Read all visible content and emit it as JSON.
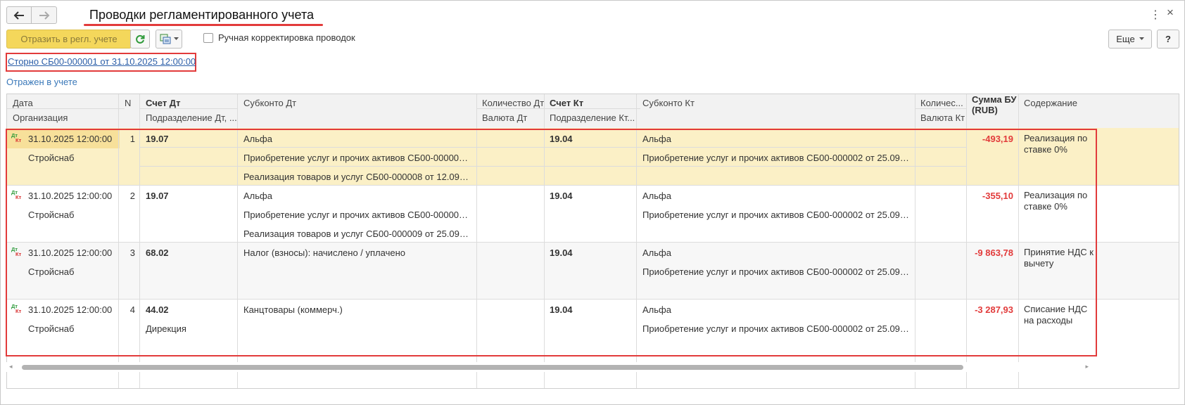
{
  "window": {
    "title": "Проводки регламентированного учета",
    "back_icon": "arrow-left-icon",
    "forward_icon": "arrow-right-icon",
    "menu_icon": "more-vertical-icon",
    "close_icon": "close-icon",
    "close_glyph": "×",
    "menu_glyph": "⋮"
  },
  "toolbar": {
    "post_label": "Отразить в регл. учете",
    "refresh_icon": "refresh-icon",
    "copy_icon": "copy-structure-icon",
    "manual_checkbox_label": "Ручная корректировка проводок",
    "manual_checked": false,
    "more_label": "Еще",
    "help_label": "?"
  },
  "links": {
    "storno": "Сторно СБ00-000001 от 31.10.2025 12:00:00",
    "status": "Отражен в учете"
  },
  "colors": {
    "accent_yellow": "#f4d75b",
    "selected_row": "#fbf0c6",
    "negative": "#e23b3b",
    "link": "#2b5ea8",
    "dt_green": "#2d9a3a",
    "kt_red": "#d83030"
  },
  "table": {
    "headers": {
      "date": "Дата",
      "org": "Организация",
      "n": "N",
      "acc_dt": "Счет Дт",
      "dept_dt": "Подразделение Дт, ...",
      "sub_dt": "Субконто Дт",
      "qty_dt": "Количество Дт",
      "cur_dt": "Валюта Дт",
      "acc_kt": "Счет Кт",
      "dept_kt": "Подразделение Кт...",
      "sub_kt": "Субконто Кт",
      "qty_kt": "Количес...",
      "cur_kt": "Валюта Кт",
      "sum": "Сумма БУ (RUB)",
      "content": "Содержание"
    },
    "dtkt": {
      "dt": "Дт",
      "kt": "Кт"
    },
    "rows": [
      {
        "date": "31.10.2025 12:00:00",
        "org": "Стройснаб",
        "n": "1",
        "acc_dt": "19.07",
        "dept_dt": "",
        "sub_dt": [
          "Альфа",
          "Приобретение услуг и прочих активов СБ00-000002 от ...",
          "Реализация товаров и услуг СБ00-000008 от 12.09.202..."
        ],
        "acc_kt": "19.04",
        "sub_kt": [
          "Альфа",
          "Приобретение услуг и прочих активов СБ00-000002 от 25.09.2025..."
        ],
        "sum": "-493,19",
        "content": "Реализация по ставке 0%"
      },
      {
        "date": "31.10.2025 12:00:00",
        "org": "Стройснаб",
        "n": "2",
        "acc_dt": "19.07",
        "dept_dt": "",
        "sub_dt": [
          "Альфа",
          "Приобретение услуг и прочих активов СБ00-000002 от ...",
          "Реализация товаров и услуг СБ00-000009 от 25.09.202..."
        ],
        "acc_kt": "19.04",
        "sub_kt": [
          "Альфа",
          "Приобретение услуг и прочих активов СБ00-000002 от 25.09.2025..."
        ],
        "sum": "-355,10",
        "content": "Реализация по ставке 0%"
      },
      {
        "date": "31.10.2025 12:00:00",
        "org": "Стройснаб",
        "n": "3",
        "acc_dt": "68.02",
        "dept_dt": "",
        "sub_dt": [
          "Налог (взносы): начислено / уплачено"
        ],
        "acc_kt": "19.04",
        "sub_kt": [
          "Альфа",
          "Приобретение услуг и прочих активов СБ00-000002 от 25.09.2025..."
        ],
        "sum": "-9 863,78",
        "content": "Принятие НДС к вычету"
      },
      {
        "date": "31.10.2025 12:00:00",
        "org": "Стройснаб",
        "n": "4",
        "acc_dt": "44.02",
        "dept_dt": "Дирекция",
        "sub_dt": [
          "Канцтовары (коммерч.)"
        ],
        "acc_kt": "19.04",
        "sub_kt": [
          "Альфа",
          "Приобретение услуг и прочих активов СБ00-000002 от 25.09.2025..."
        ],
        "sum": "-3 287,93",
        "content": "Списание НДС на расходы"
      }
    ]
  },
  "scrollbar": {
    "arrow_left": "◂",
    "arrow_right": "▸"
  }
}
